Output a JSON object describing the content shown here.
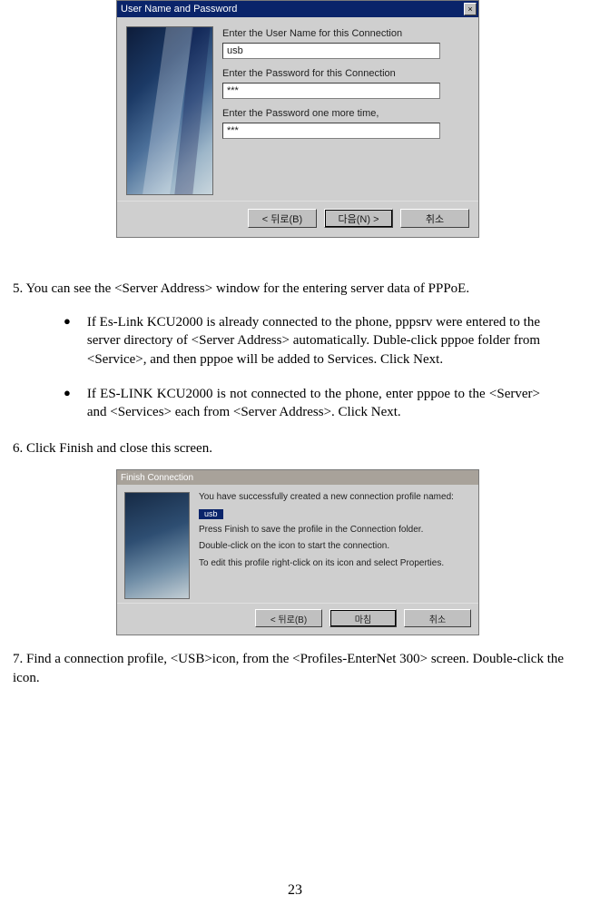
{
  "dialog1": {
    "title": "User Name and Password",
    "close_glyph": "×",
    "labels": {
      "username": "Enter the User Name for this Connection",
      "password": "Enter the Password for this Connection",
      "confirm": "Enter the Password one more time,"
    },
    "values": {
      "username": "usb",
      "password": "***",
      "confirm": "***"
    },
    "buttons": {
      "back": "< 뒤로(B)",
      "next": "다음(N) >",
      "cancel": "취소"
    }
  },
  "step5": "5. You can see the <Server Address> window for the  entering server data of PPPoE.",
  "bullets": [
    "If Es-Link KCU2000  is  already connected to the phone, pppsrv were entered  to the server directory  of <Server Address> automatically. Duble-click pppoe folder from <Service>, and then pppoe will be added to Services. Click Next.",
    "If ES-LINK KCU2000 is not connected to the phone, enter pppoe to  the <Server> and <Services> each  from <Server Address>. Click Next."
  ],
  "step6": "6. Click Finish and close this screen.",
  "dialog2": {
    "title": "Finish Connection",
    "chip": "usb",
    "lines": [
      "You have successfully created a new connection profile named:",
      "Press Finish to save the profile in the Connection folder.",
      "Double-click on the icon to start the connection.",
      "To edit this profile right-click on its icon and select Properties."
    ],
    "buttons": {
      "back": "< 뒤로(B)",
      "finish": "마침",
      "cancel": "취소"
    }
  },
  "step7": "7. Find a connection profile, <USB>icon, from the  <Profiles-EnterNet 300> screen. Double-click  the icon.",
  "page_number": "23"
}
